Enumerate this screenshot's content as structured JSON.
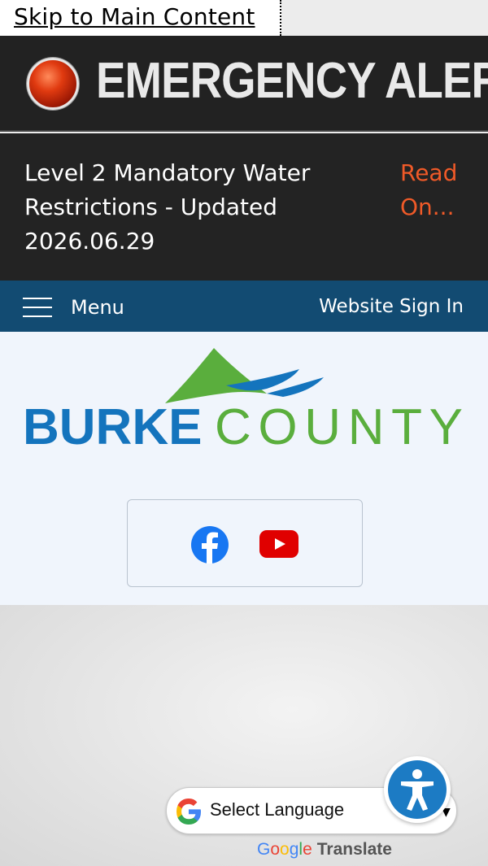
{
  "skip_link": {
    "label": "Skip to Main Content"
  },
  "emergency": {
    "title": "EMERGENCY ALERT",
    "message": "Level 2 Mandatory Water Restrictions - Updated 2026.06.29",
    "read_more": "Read On..."
  },
  "navbar": {
    "menu_label": "Menu",
    "sign_in": "Website Sign In"
  },
  "logo": {
    "part1": "BURKE",
    "part2": "COUNTY",
    "colors": {
      "burke": "#1474bd",
      "county": "#5aae3d"
    }
  },
  "social": {
    "icons": [
      "facebook-icon",
      "youtube-icon"
    ]
  },
  "translate": {
    "select_label": "Select Language",
    "google": [
      "G",
      "o",
      "o",
      "g",
      "l",
      "e"
    ],
    "translate_word": "Translate"
  },
  "colors": {
    "alert_bg": "#222222",
    "alert_link": "#f05a28",
    "nav_bg": "#124b72",
    "header_bg": "#f0f5fc",
    "accessibility": "#1c7bc4"
  }
}
